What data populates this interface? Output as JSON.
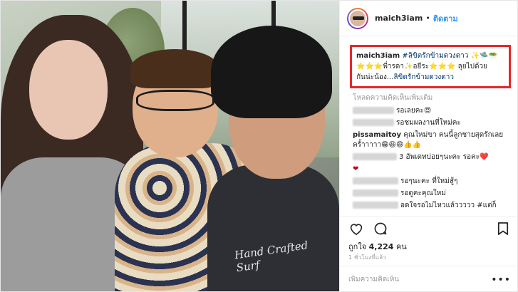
{
  "post": {
    "username": "maich3iam",
    "follow_label": "ติดตาม",
    "separator": "•"
  },
  "caption": {
    "username": "maich3iam",
    "hashtag_top": "#ลิขิตรักข้ามดวงดาว",
    "line1_tail": " ✨🛸🥗",
    "line2": "⭐⭐⭐พี่ารดา✨อยีระ⭐⭐⭐ ลุยไปด้วย",
    "line3_prefix": "กันน่ะน้อง...",
    "hashtag_bottom": "ลิขิตรักข้ามดวงดาว"
  },
  "load_more": "โหลดความคิดเห็นเพิ่มเติม",
  "comments": [
    {
      "user": "",
      "text": "รอเลยคะ😍"
    },
    {
      "user": "",
      "text": "รอชมผลงานที่ใหม่คะ"
    },
    {
      "user": "pissamaitoy",
      "text": "คุณใหม่ขา คนนี้ลูกชายสุดรักเลยครั้าาาาา😁😆😄👍👍"
    },
    {
      "user": "",
      "text": "3 อัพเดทบ่อยๆนะคะ รอคะ❤️"
    },
    {
      "user": "",
      "text": "❤"
    },
    {
      "user": "",
      "text": "รอๆนะคะ ที่ใหม่สู้ๆ"
    },
    {
      "user": "",
      "text": "รอดูคะคุณใหม่"
    },
    {
      "user": "",
      "text": "อดใจรอไม่ไหวแล้ววววว #แต่ก็"
    }
  ],
  "likes": {
    "prefix": "ถูกใจ",
    "count": "4,224",
    "suffix": "คน"
  },
  "timestamp": "1 ชั่วโมงที่แล้ว",
  "add_comment_placeholder": "เพิ่มความคิดเห็น",
  "more_label": "•••",
  "photo": {
    "shirt_text": "Hand Crafted Surf"
  },
  "colors": {
    "highlight_box": "#e8262a",
    "link_blue": "#3897f0",
    "hashtag": "#003569"
  },
  "icons": {
    "like": "heart-icon",
    "comment": "comment-icon",
    "share": "share-icon",
    "save": "bookmark-icon"
  }
}
